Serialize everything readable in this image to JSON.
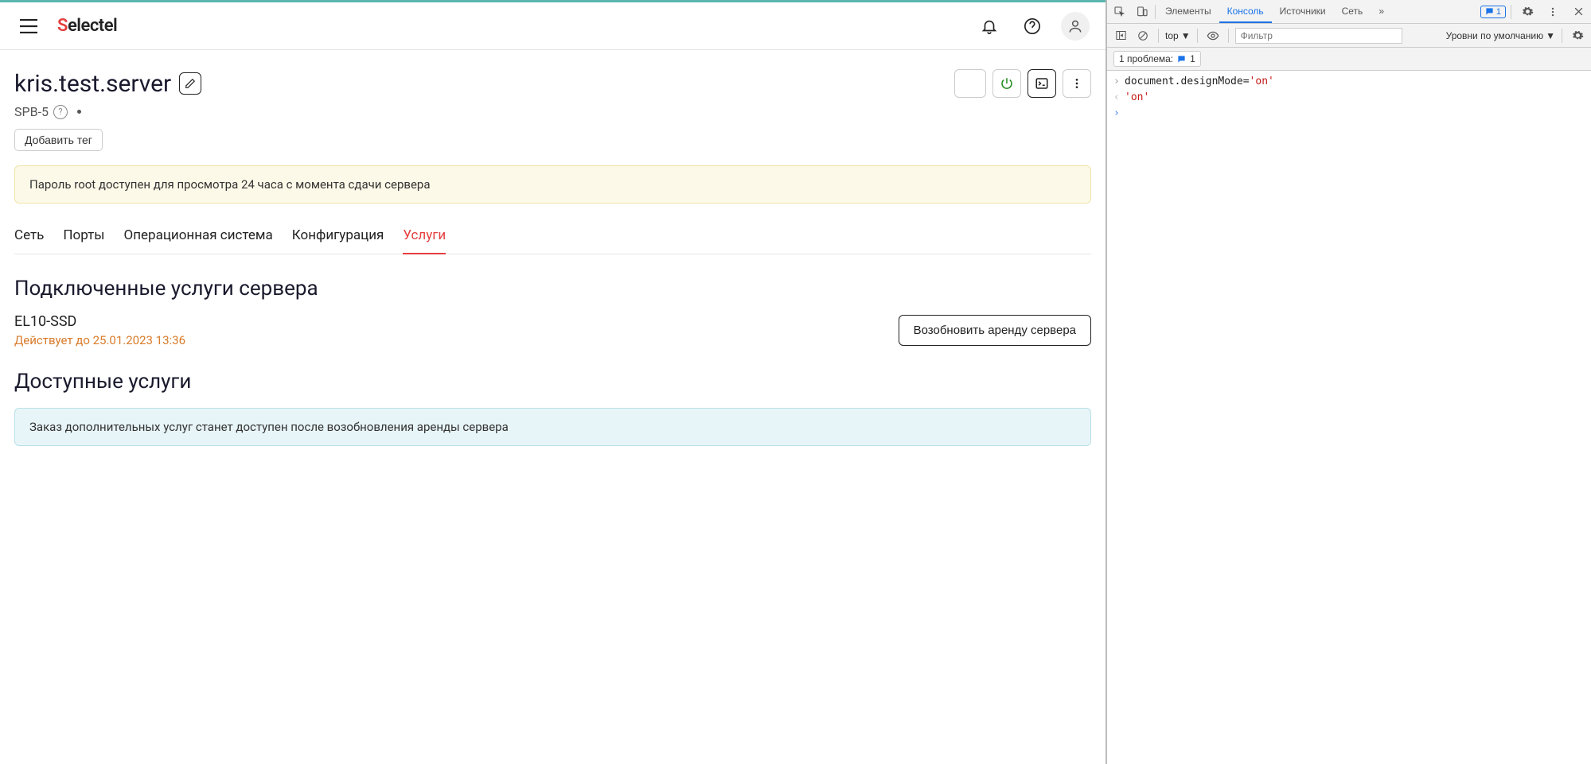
{
  "header": {
    "logo_text": "Selectel"
  },
  "page": {
    "title": "kris.test.server",
    "location": "SPB-5",
    "add_tag_label": "Добавить тег",
    "warning": "Пароль root доступен для просмотра 24 часа с момента сдачи сервера"
  },
  "tabs": [
    {
      "label": "Сеть",
      "active": false
    },
    {
      "label": "Порты",
      "active": false
    },
    {
      "label": "Операционная система",
      "active": false
    },
    {
      "label": "Конфигурация",
      "active": false
    },
    {
      "label": "Услуги",
      "active": true
    }
  ],
  "connected_section": {
    "title": "Подключенные услуги сервера",
    "service_name": "EL10-SSD",
    "expires": "Действует до 25.01.2023 13:36",
    "renew_label": "Возобновить аренду сервера"
  },
  "available_section": {
    "title": "Доступные услуги",
    "info": "Заказ дополнительных услуг станет доступен после возобновления аренды сервера"
  },
  "devtools": {
    "tabs": {
      "elements": "Элементы",
      "console": "Консоль",
      "sources": "Источники",
      "network": "Сеть"
    },
    "issues_count": "1",
    "context": "top",
    "filter_placeholder": "Фильтр",
    "levels": "Уровни по умолчанию",
    "issues_bar": "1 проблема:",
    "issues_bar_count": "1",
    "console_lines": {
      "input_prefix": "document.designMode=",
      "input_value": "'on'",
      "output": "'on'"
    }
  }
}
